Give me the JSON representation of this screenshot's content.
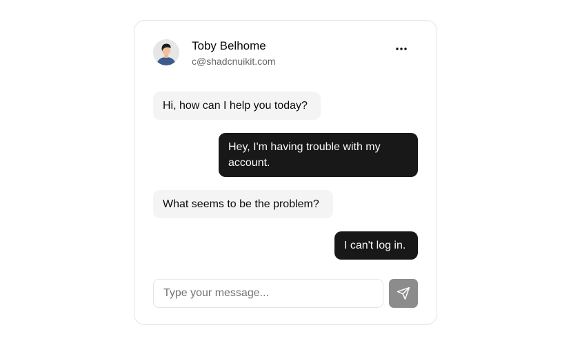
{
  "contact": {
    "name": "Toby Belhome",
    "email": "c@shadcnuikit.com",
    "avatar_icon": "person-avatar",
    "more_icon": "more-horizontal-icon"
  },
  "messages": [
    {
      "sender": "agent",
      "text": "Hi, how can I help you today?"
    },
    {
      "sender": "user",
      "text": "Hey, I'm having trouble with my account."
    },
    {
      "sender": "agent",
      "text": "What seems to be the problem?"
    },
    {
      "sender": "user",
      "text": "I can't log in."
    }
  ],
  "composer": {
    "placeholder": "Type your message...",
    "value": "",
    "send_icon": "send-icon"
  },
  "colors": {
    "outgoing_bubble": "#181818",
    "incoming_bubble": "#f4f4f5",
    "send_button": "#8c8c8c",
    "border": "#e4e4e7"
  }
}
